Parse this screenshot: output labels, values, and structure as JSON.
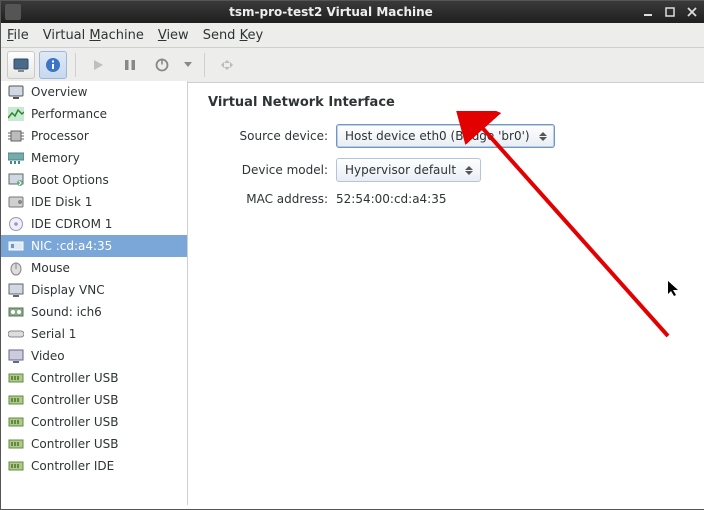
{
  "window": {
    "title": "tsm-pro-test2 Virtual Machine"
  },
  "menu": {
    "file": "File",
    "vm": "Virtual Machine",
    "view": "View",
    "sendkey": "Send Key"
  },
  "sidebar": {
    "items": [
      {
        "label": "Overview",
        "icon": "overview"
      },
      {
        "label": "Performance",
        "icon": "perf"
      },
      {
        "label": "Processor",
        "icon": "cpu"
      },
      {
        "label": "Memory",
        "icon": "ram"
      },
      {
        "label": "Boot Options",
        "icon": "boot"
      },
      {
        "label": "IDE Disk 1",
        "icon": "disk"
      },
      {
        "label": "IDE CDROM 1",
        "icon": "cd"
      },
      {
        "label": "NIC :cd:a4:35",
        "icon": "nic",
        "selected": true
      },
      {
        "label": "Mouse",
        "icon": "mouse"
      },
      {
        "label": "Display VNC",
        "icon": "display"
      },
      {
        "label": "Sound: ich6",
        "icon": "sound"
      },
      {
        "label": "Serial 1",
        "icon": "serial"
      },
      {
        "label": "Video",
        "icon": "video"
      },
      {
        "label": "Controller USB",
        "icon": "ctrl"
      },
      {
        "label": "Controller USB",
        "icon": "ctrl"
      },
      {
        "label": "Controller USB",
        "icon": "ctrl"
      },
      {
        "label": "Controller USB",
        "icon": "ctrl"
      },
      {
        "label": "Controller IDE",
        "icon": "ctrl"
      }
    ]
  },
  "panel": {
    "heading": "Virtual Network Interface",
    "source_label": "Source device:",
    "source_value": "Host device eth0 (Bridge 'br0')",
    "model_label": "Device model:",
    "model_value": "Hypervisor default",
    "mac_label": "MAC address:",
    "mac_value": "52:54:00:cd:a4:35"
  }
}
